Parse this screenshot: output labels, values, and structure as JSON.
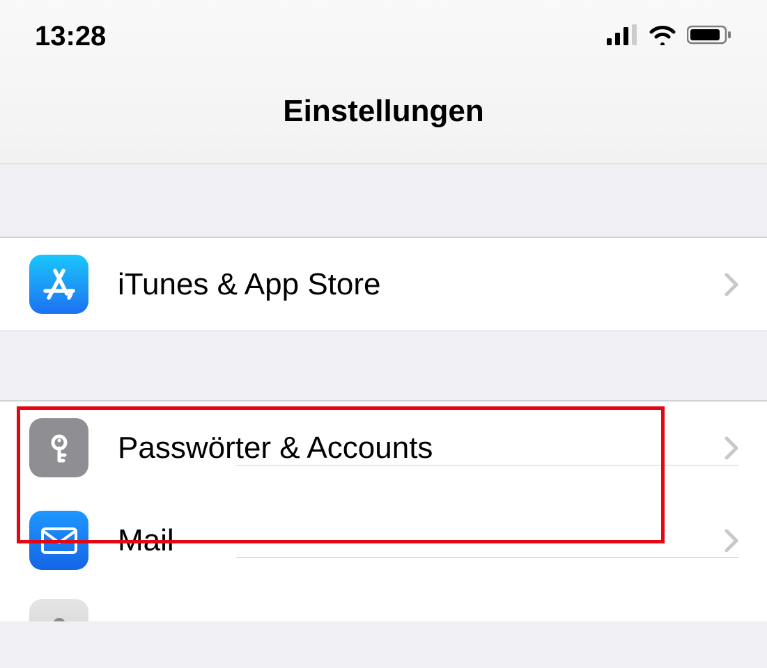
{
  "status": {
    "time": "13:28"
  },
  "header": {
    "title": "Einstellungen"
  },
  "groups": [
    {
      "items": [
        {
          "id": "itunes",
          "label": "iTunes & App Store",
          "icon": "appstore"
        }
      ]
    },
    {
      "items": [
        {
          "id": "passwords",
          "label": "Passwörter & Accounts",
          "icon": "key"
        },
        {
          "id": "mail",
          "label": "Mail",
          "icon": "mail"
        },
        {
          "id": "contacts",
          "label": "",
          "icon": "contacts"
        }
      ]
    }
  ]
}
